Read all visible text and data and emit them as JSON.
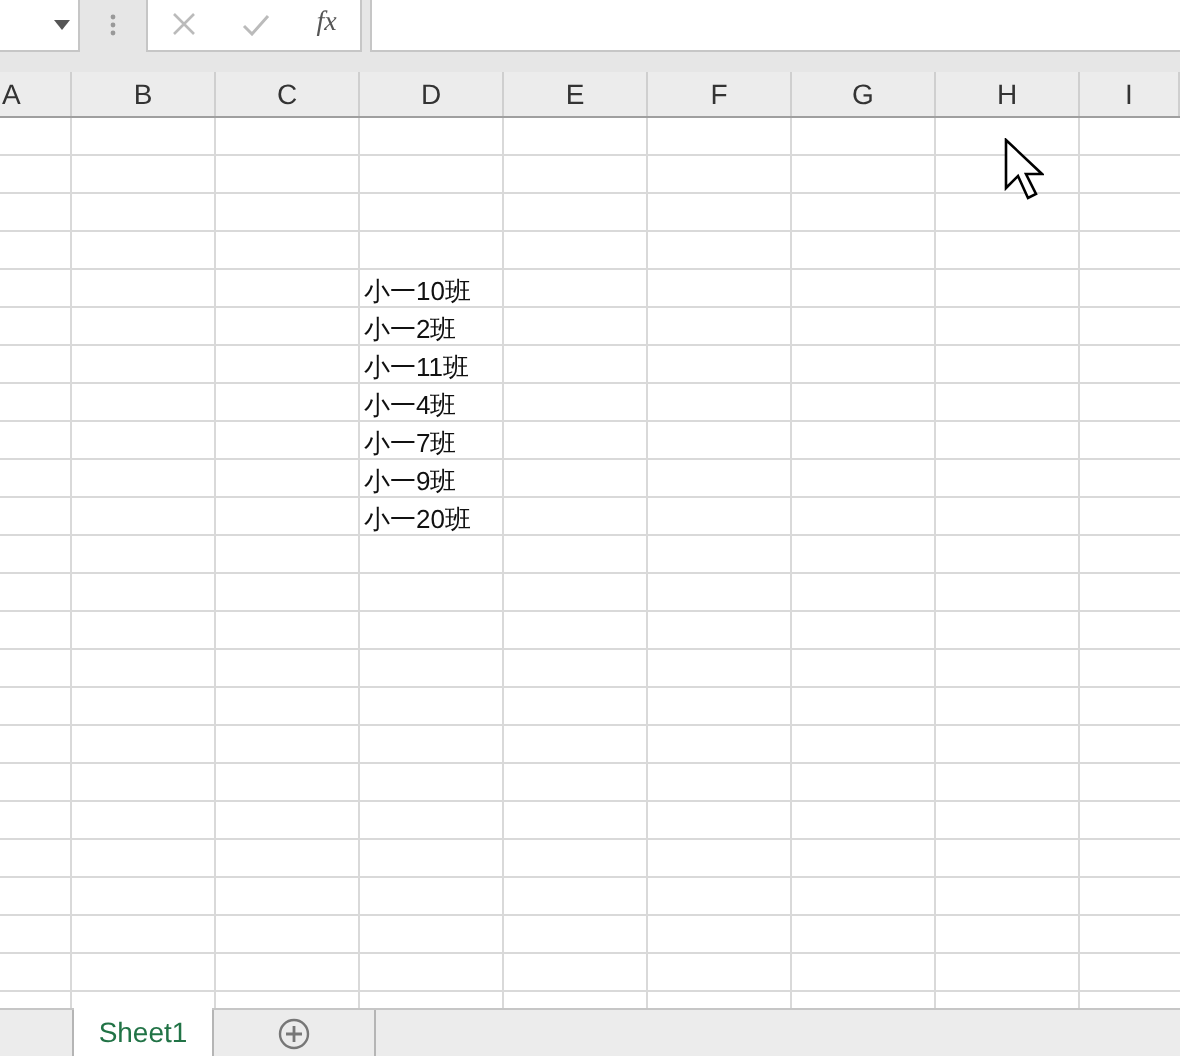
{
  "formula_bar": {
    "function_button": "fx"
  },
  "sheet": {
    "columns": [
      "A",
      "B",
      "C",
      "D",
      "E",
      "F",
      "G",
      "H",
      "I"
    ],
    "column_d_cells": [
      "小一10班",
      "小一2班",
      "小一11班",
      "小一4班",
      "小一7班",
      "小一9班",
      "小一20班"
    ]
  },
  "sheet_tabs": [
    {
      "label": "Sheet1",
      "selected": true
    }
  ]
}
